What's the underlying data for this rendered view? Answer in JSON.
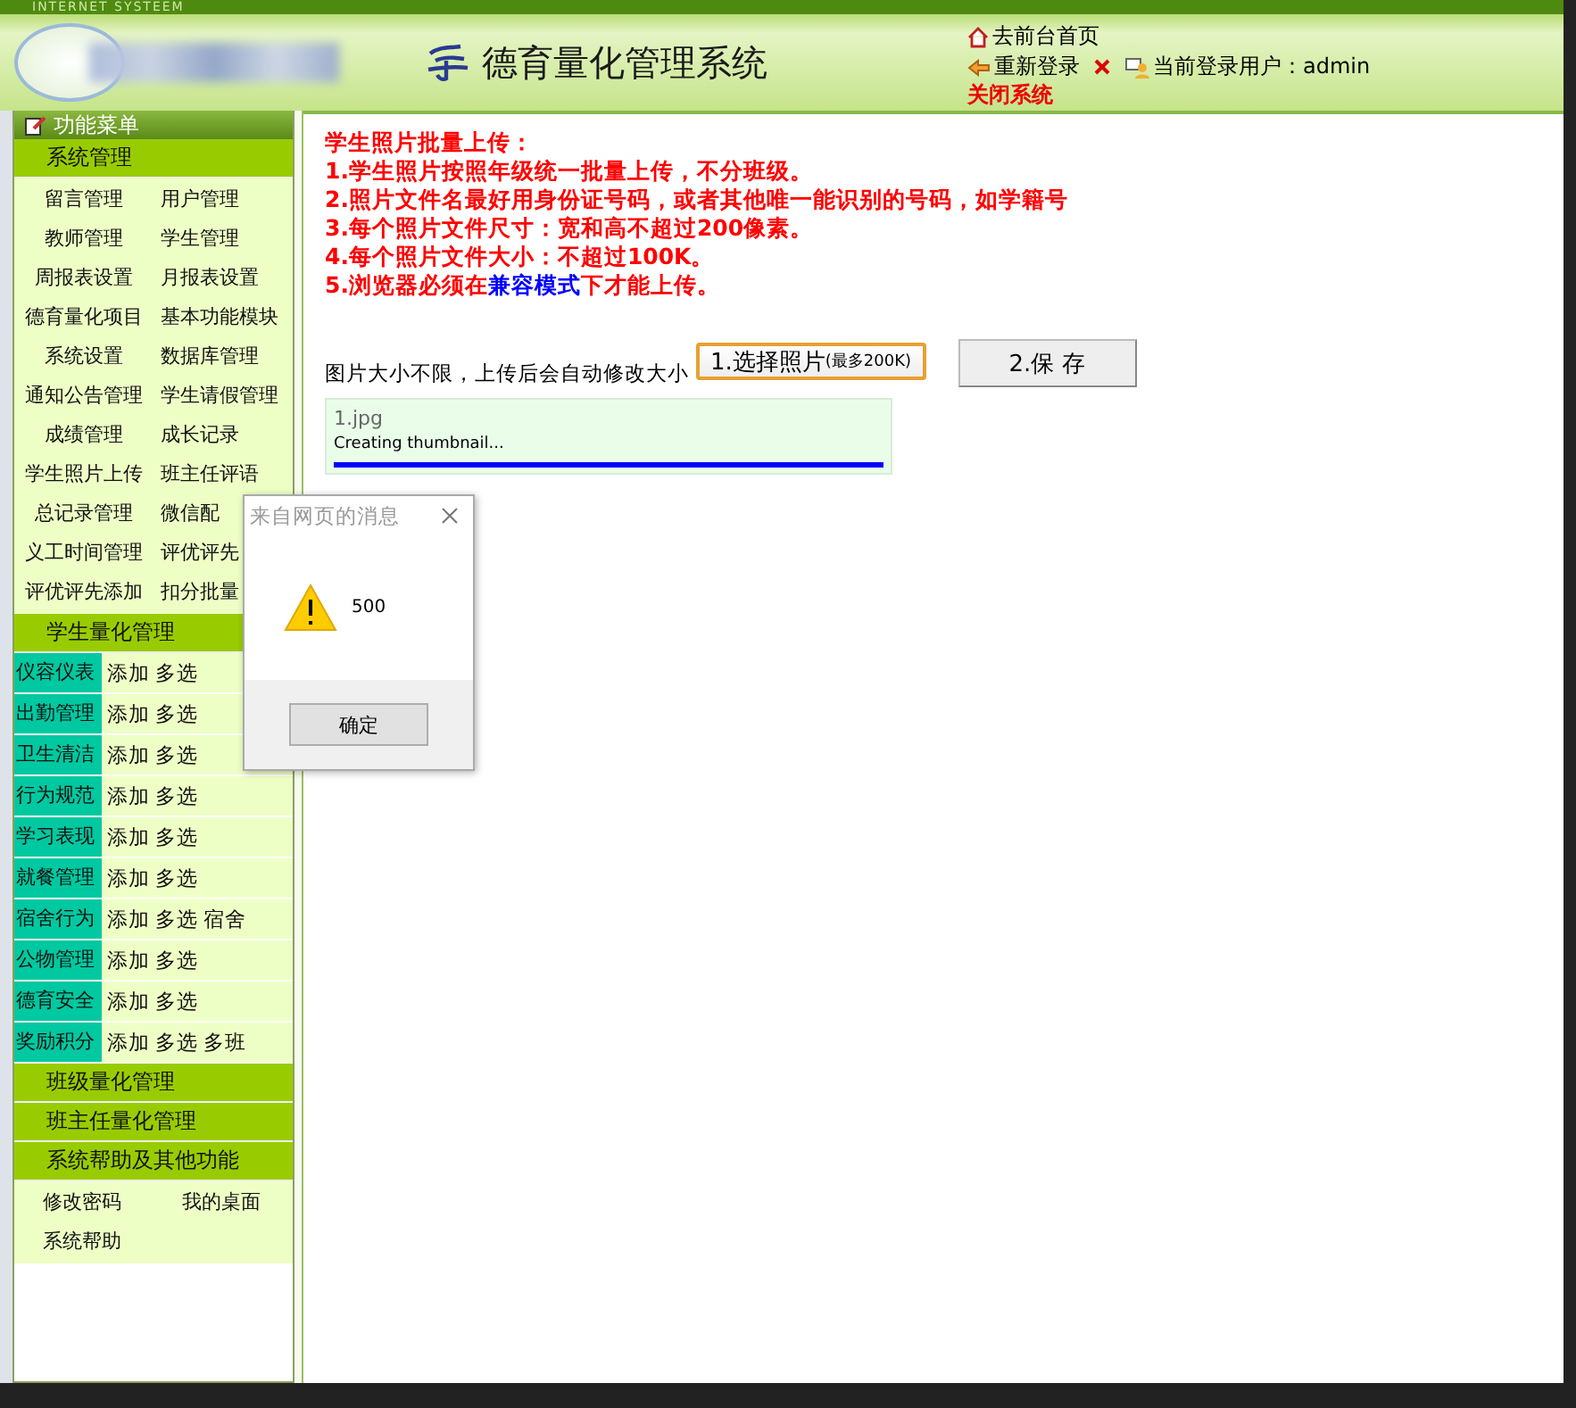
{
  "header": {
    "banner_label": "INTERNET SYSTEEM",
    "title": "德育量化管理系统",
    "links": [
      {
        "text": "去前台首页",
        "kind": "home"
      },
      {
        "text": "重新登录",
        "kind": "relogin"
      }
    ],
    "close": "关闭系统",
    "user_label": "当前登录用户：admin"
  },
  "sidebar": {
    "title": "功能菜单",
    "sections": [
      {
        "title": "系统管理",
        "items": [
          "留言管理",
          "用户管理",
          "教师管理",
          "学生管理",
          "周报表设置",
          "月报表设置",
          "德育量化项目",
          "基本功能模块",
          "系统设置",
          "数据库管理",
          "通知公告管理",
          "学生请假管理",
          "成绩管理",
          "成长记录",
          "学生照片上传",
          "班主任评语",
          "总记录管理",
          "微信配",
          "义工时间管理",
          "评优评先",
          "评优评先添加",
          "扣分批量"
        ]
      },
      {
        "title": "学生量化管理",
        "rows": [
          {
            "name": "仪容仪表",
            "actions": [
              "添加",
              "多选"
            ]
          },
          {
            "name": "出勤管理",
            "actions": [
              "添加",
              "多选"
            ]
          },
          {
            "name": "卫生清洁",
            "actions": [
              "添加",
              "多选"
            ]
          },
          {
            "name": "行为规范",
            "actions": [
              "添加",
              "多选"
            ]
          },
          {
            "name": "学习表现",
            "actions": [
              "添加",
              "多选"
            ]
          },
          {
            "name": "就餐管理",
            "actions": [
              "添加",
              "多选"
            ]
          },
          {
            "name": "宿舍行为",
            "actions": [
              "添加",
              "多选",
              "宿舍"
            ]
          },
          {
            "name": "公物管理",
            "actions": [
              "添加",
              "多选"
            ]
          },
          {
            "name": "德育安全",
            "actions": [
              "添加",
              "多选"
            ]
          },
          {
            "name": "奖励积分",
            "actions": [
              "添加",
              "多选",
              "多班"
            ]
          }
        ]
      },
      {
        "title": "班级量化管理"
      },
      {
        "title": "班主任量化管理"
      },
      {
        "title": "系统帮助及其他功能",
        "items": [
          "修改密码",
          "我的桌面",
          "系统帮助"
        ]
      }
    ]
  },
  "main": {
    "notice_title": "学生照片批量上传：",
    "notices": [
      [
        {
          "text": "1.学生照片按照年级统一批量上传，不分班级。",
          "highlight": false
        }
      ],
      [
        {
          "text": "2.照片文件名最好用身份证号码，或者其他唯一能识别的号码，如学籍号",
          "highlight": false
        }
      ],
      [
        {
          "text": "3.每个照片文件尺寸：宽和高不超过200像素。",
          "highlight": false
        }
      ],
      [
        {
          "text": "4.每个照片文件大小：不超过100K。",
          "highlight": false
        }
      ],
      [
        {
          "text": "5.浏览器必须在",
          "highlight": false
        },
        {
          "text": "兼容模式",
          "highlight": true
        },
        {
          "text": "下才能上传。",
          "highlight": false
        }
      ]
    ],
    "hint": "图片大小不限，上传后会自动修改大小",
    "select_button": "1.选择照片",
    "select_note": "(最多200K)",
    "save_button": "2.保 存",
    "upload": {
      "filename": "1.jpg",
      "status": "Creating thumbnail...",
      "level": 1
    }
  },
  "dialog": {
    "title": "来自网页的消息",
    "message": "500",
    "ok": "确定"
  }
}
